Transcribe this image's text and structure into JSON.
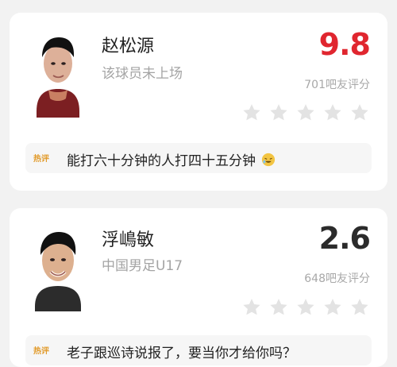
{
  "players": [
    {
      "name": "赵松源",
      "subtitle": "该球员未上场",
      "score": "9.8",
      "rating_count": "701吧友评分",
      "stars": 5,
      "comment_badge": "热评",
      "comment": "能打六十分钟的人打四十五分钟"
    },
    {
      "name": "浮嶋敏",
      "subtitle": "中国男足U17",
      "score": "2.6",
      "rating_count": "648吧友评分",
      "stars": 5,
      "comment_badge": "热评",
      "comment": "老子跟巡诗说报了，要当你才给你吗？"
    }
  ],
  "colors": {
    "high_score": "#e0262f",
    "low_score": "#2b2b2b",
    "star": "#e3e3e3",
    "badge": "#e29b2b"
  }
}
